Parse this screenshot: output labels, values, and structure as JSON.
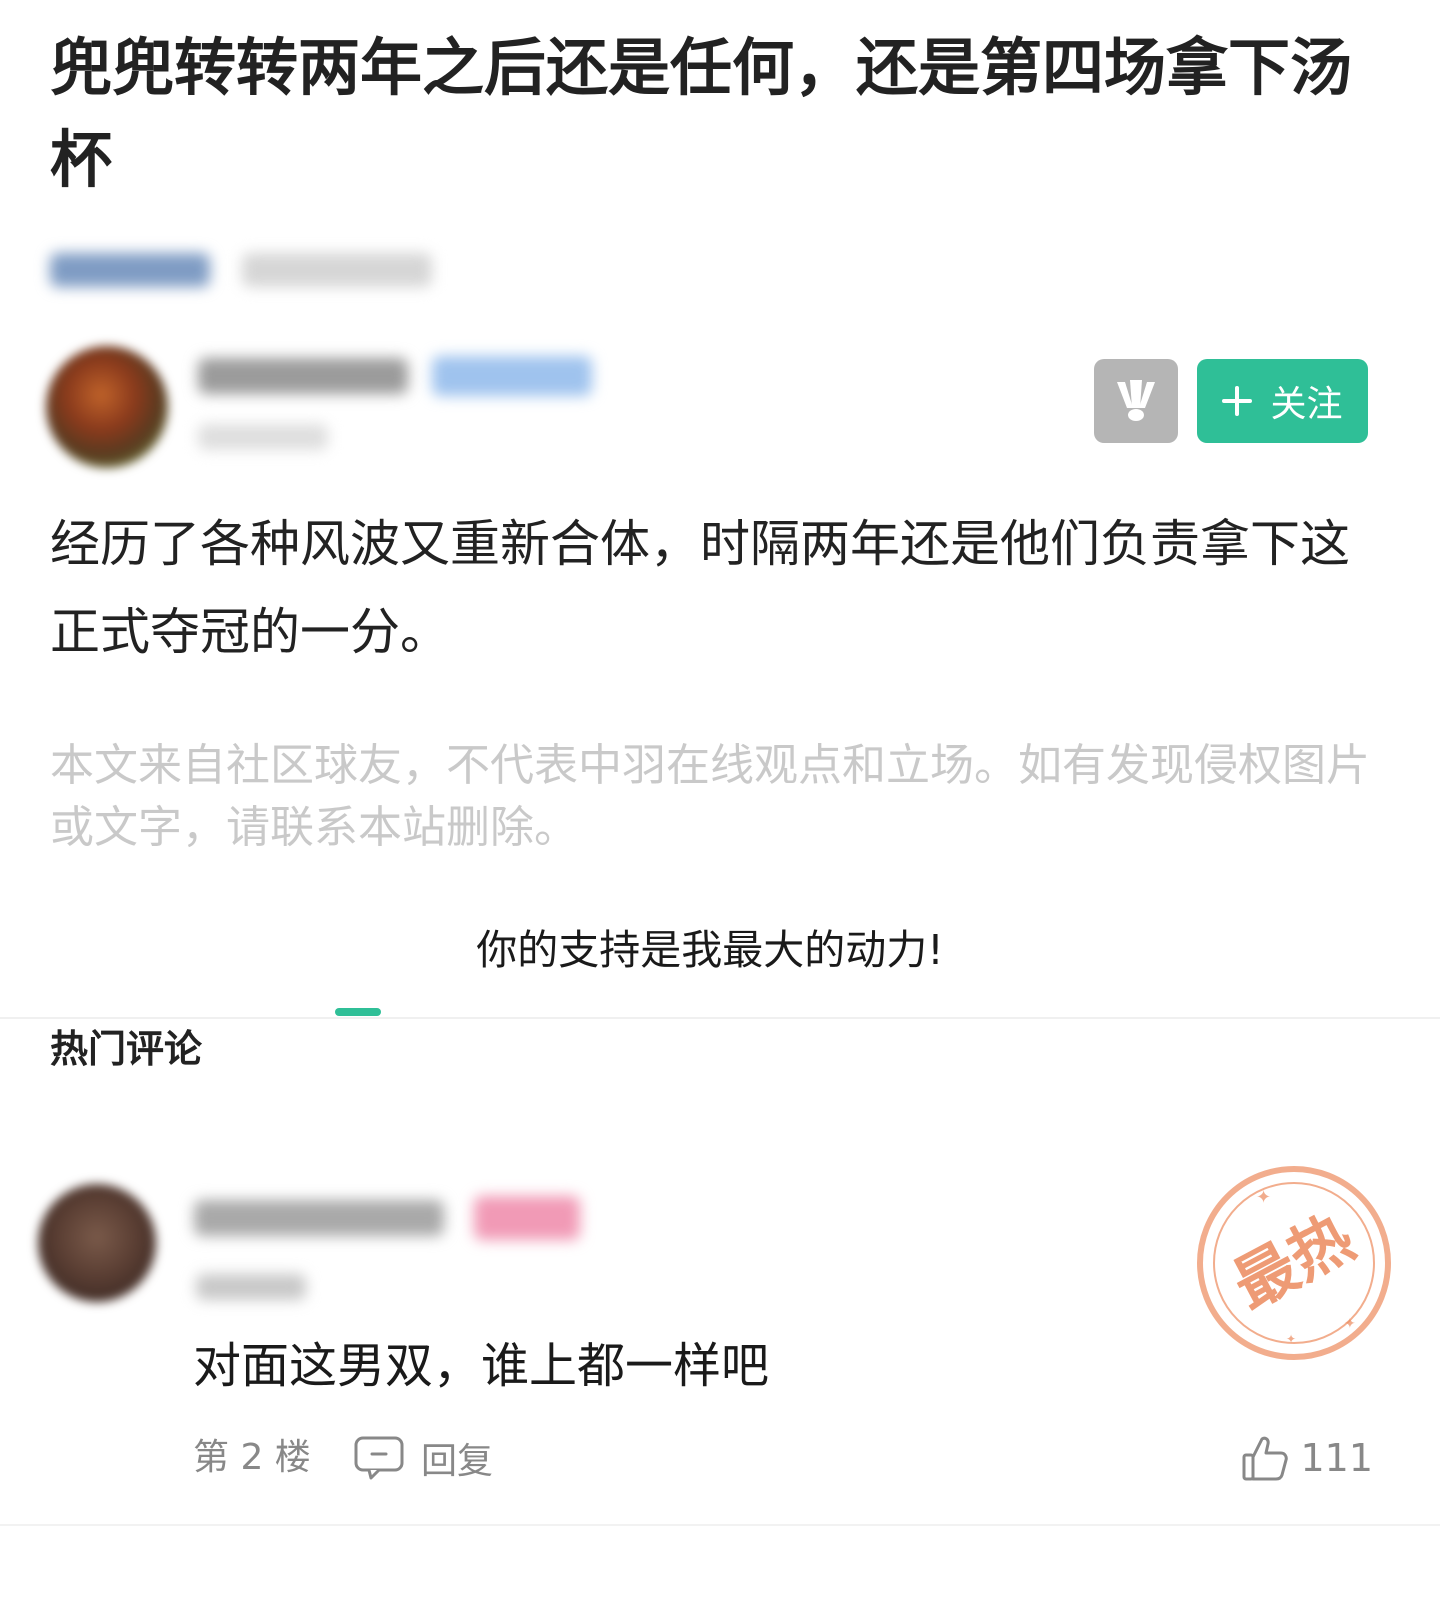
{
  "article": {
    "title": "兜兜转转两年之后还是任何，还是第四场拿下汤杯",
    "body": "经历了各种风波又重新合体，时隔两年还是他们负责拿下这正式夺冠的一分。",
    "disclaimer": "本文来自社区球友，不代表中羽在线观点和立场。如有发现侵权图片或文字，请联系本站删除。",
    "support_text": "你的支持是我最大的动力!"
  },
  "author": {
    "follow_label": "关注",
    "favorite_icon": "shuttlecock-icon"
  },
  "comments_section": {
    "title": "热门评论"
  },
  "comment": {
    "text": "对面这男双，谁上都一样吧",
    "floor": "第 2 楼",
    "reply_label": "回复",
    "likes": "111",
    "stamp": "最热"
  },
  "colors": {
    "accent": "#2fbf97",
    "stamp": "#ec8a5d",
    "muted": "#888888"
  }
}
